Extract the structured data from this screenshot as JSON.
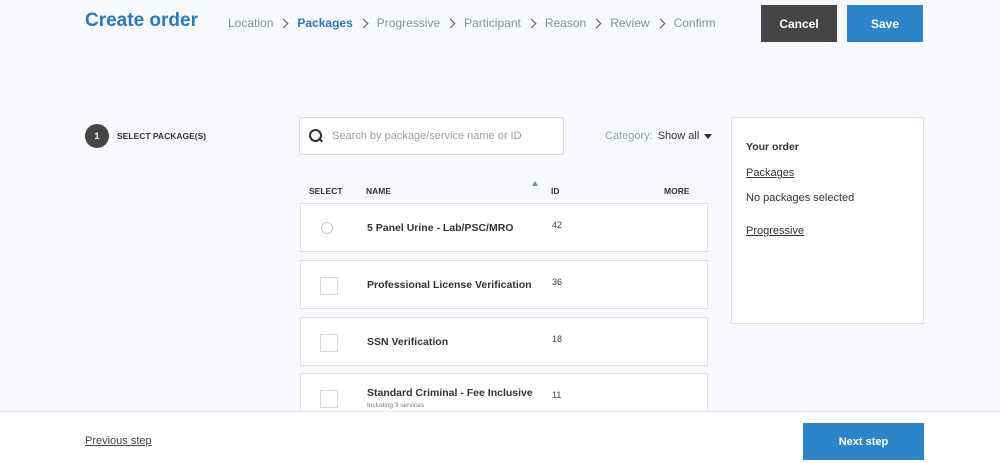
{
  "header": {
    "title": "Create order",
    "steps": [
      {
        "label": "Location",
        "active": false
      },
      {
        "label": "Packages",
        "active": true
      },
      {
        "label": "Progressive",
        "active": false
      },
      {
        "label": "Participant",
        "active": false
      },
      {
        "label": "Reason",
        "active": false
      },
      {
        "label": "Review",
        "active": false
      },
      {
        "label": "Confirm",
        "active": false
      }
    ],
    "cancel_label": "Cancel",
    "save_label": "Save"
  },
  "section": {
    "number": "1",
    "label": "SELECT PACKAGE(S)"
  },
  "search": {
    "value": "",
    "placeholder": "Search by package/service name or ID"
  },
  "category": {
    "label": "Category:",
    "value": "Show all"
  },
  "table": {
    "headers": {
      "select": "SELECT",
      "name": "NAME",
      "id": "ID",
      "more": "MORE"
    },
    "rows": [
      {
        "name": "5 Panel Urine - Lab/PSC/MRO",
        "sub": "",
        "id": "42",
        "select_type": "radio"
      },
      {
        "name": "Professional License Verification",
        "sub": "",
        "id": "36",
        "select_type": "checkbox"
      },
      {
        "name": "SSN Verification",
        "sub": "",
        "id": "18",
        "select_type": "checkbox"
      },
      {
        "name": "Standard Criminal - Fee Inclusive",
        "sub": "Including 3 services",
        "id": "11",
        "select_type": "checkbox"
      }
    ]
  },
  "order": {
    "title": "Your order",
    "packages_link": "Packages",
    "packages_empty": "No packages selected",
    "progressive_link": "Progressive"
  },
  "footer": {
    "previous_label": "Previous step",
    "next_label": "Next step"
  },
  "colors": {
    "accent": "#2d84c8",
    "title": "#2a7ab8",
    "dark_button": "#454545",
    "background": "#f7f9fc"
  }
}
